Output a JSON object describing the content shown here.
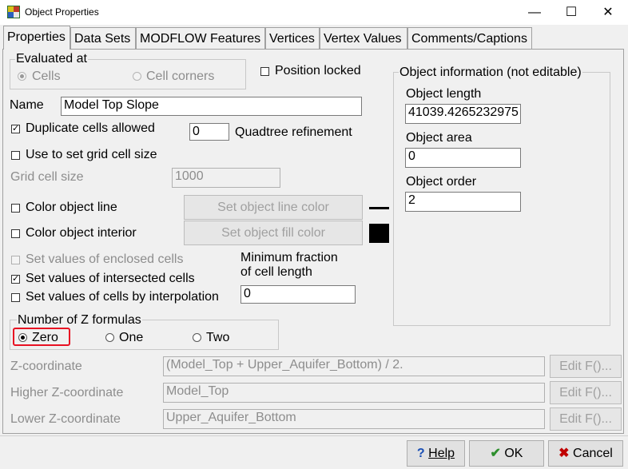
{
  "window": {
    "title": "Object Properties",
    "minimize": "—",
    "maximize": "☐",
    "close": "✕"
  },
  "tabs": [
    "Properties",
    "Data Sets",
    "MODFLOW Features",
    "Vertices",
    "Vertex Values",
    "Comments/Captions"
  ],
  "evaluated_at": {
    "legend": "Evaluated at",
    "options": [
      "Cells",
      "Cell corners"
    ],
    "selected": "Cells"
  },
  "position_locked": {
    "label": "Position locked",
    "checked": false
  },
  "name": {
    "label": "Name",
    "value": "Model Top Slope"
  },
  "duplicate_cells": {
    "label": "Duplicate cells allowed",
    "checked": true
  },
  "quadtree": {
    "value": "0",
    "label": "Quadtree refinement"
  },
  "grid_cell_size_check": {
    "label": "Use to set grid cell size",
    "checked": false
  },
  "grid_cell_size": {
    "label": "Grid cell size",
    "value": "1000"
  },
  "color_line": {
    "label": "Color object line",
    "button": "Set object line color",
    "checked": false
  },
  "color_interior": {
    "label": "Color object interior",
    "button": "Set object fill color",
    "checked": false
  },
  "enclosed": {
    "label": "Set values of enclosed cells",
    "checked": false
  },
  "intersected": {
    "label": "Set values of intersected cells",
    "checked": true
  },
  "interpolation": {
    "label": "Set values of cells by interpolation",
    "checked": false
  },
  "min_fraction": {
    "label_line1": "Minimum fraction",
    "label_line2": "of cell length",
    "value": "0"
  },
  "z_formulas": {
    "legend": "Number of Z formulas",
    "options": [
      "Zero",
      "One",
      "Two"
    ],
    "selected": "Zero"
  },
  "object_info": {
    "legend": "Object information (not editable)",
    "length_label": "Object length",
    "length_value": "41039.4265232975",
    "area_label": "Object area",
    "area_value": "0",
    "order_label": "Object order",
    "order_value": "2"
  },
  "z_coordinate": {
    "label": "Z-coordinate",
    "value": "(Model_Top + Upper_Aquifer_Bottom) / 2.",
    "button": "Edit F()..."
  },
  "higher_z": {
    "label": "Higher Z-coordinate",
    "value": "Model_Top",
    "button": "Edit F()..."
  },
  "lower_z": {
    "label": "Lower Z-coordinate",
    "value": "Upper_Aquifer_Bottom",
    "button": "Edit F()..."
  },
  "footer": {
    "help": "Help",
    "ok": "OK",
    "cancel": "Cancel"
  },
  "colors": {
    "highlight": "#e81123",
    "check_ok": "#2d8f2d",
    "cancel_x": "#c00000",
    "help_icon": "#1a4fb5"
  }
}
